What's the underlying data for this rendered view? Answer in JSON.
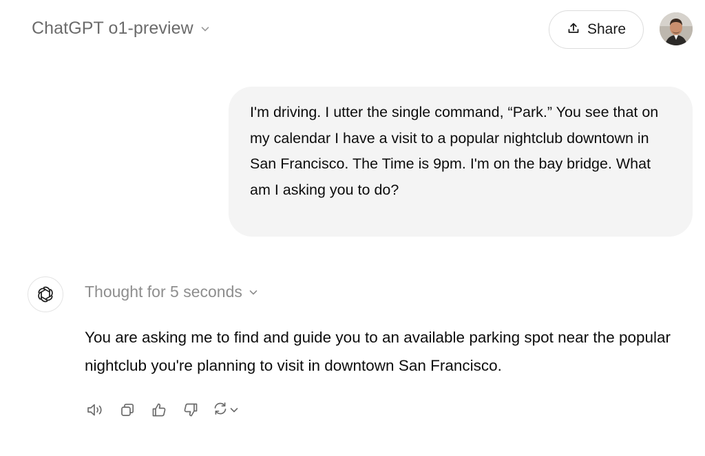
{
  "header": {
    "model_name": "ChatGPT o1-preview",
    "share_label": "Share"
  },
  "conversation": {
    "user_message": "I'm driving. I utter the single command, “Park.” You see that on my calendar I have a visit to a popular nightclub downtown in San Francisco. The Time is 9pm. I'm on the bay bridge. What am I asking you to do?",
    "assistant": {
      "thought_label": "Thought for 5 seconds",
      "answer": "You are asking me to find and guide you to an available parking spot near the popular nightclub you're planning to visit in downtown San Francisco."
    }
  },
  "icons": {
    "model_dropdown": "chevron-down-icon",
    "share": "share-upload-icon",
    "assistant_logo": "openai-logo-icon",
    "thought_toggle": "chevron-down-icon",
    "actions": [
      "read-aloud-icon",
      "copy-icon",
      "thumbs-up-icon",
      "thumbs-down-icon",
      "regenerate-icon",
      "chevron-down-icon"
    ]
  },
  "colors": {
    "user_bubble_bg": "#f4f4f4",
    "muted_text": "#8e8e8e",
    "model_name_text": "#6b6b6b",
    "body_text": "#0d0d0d",
    "icon_gray": "#6b6b6b"
  }
}
